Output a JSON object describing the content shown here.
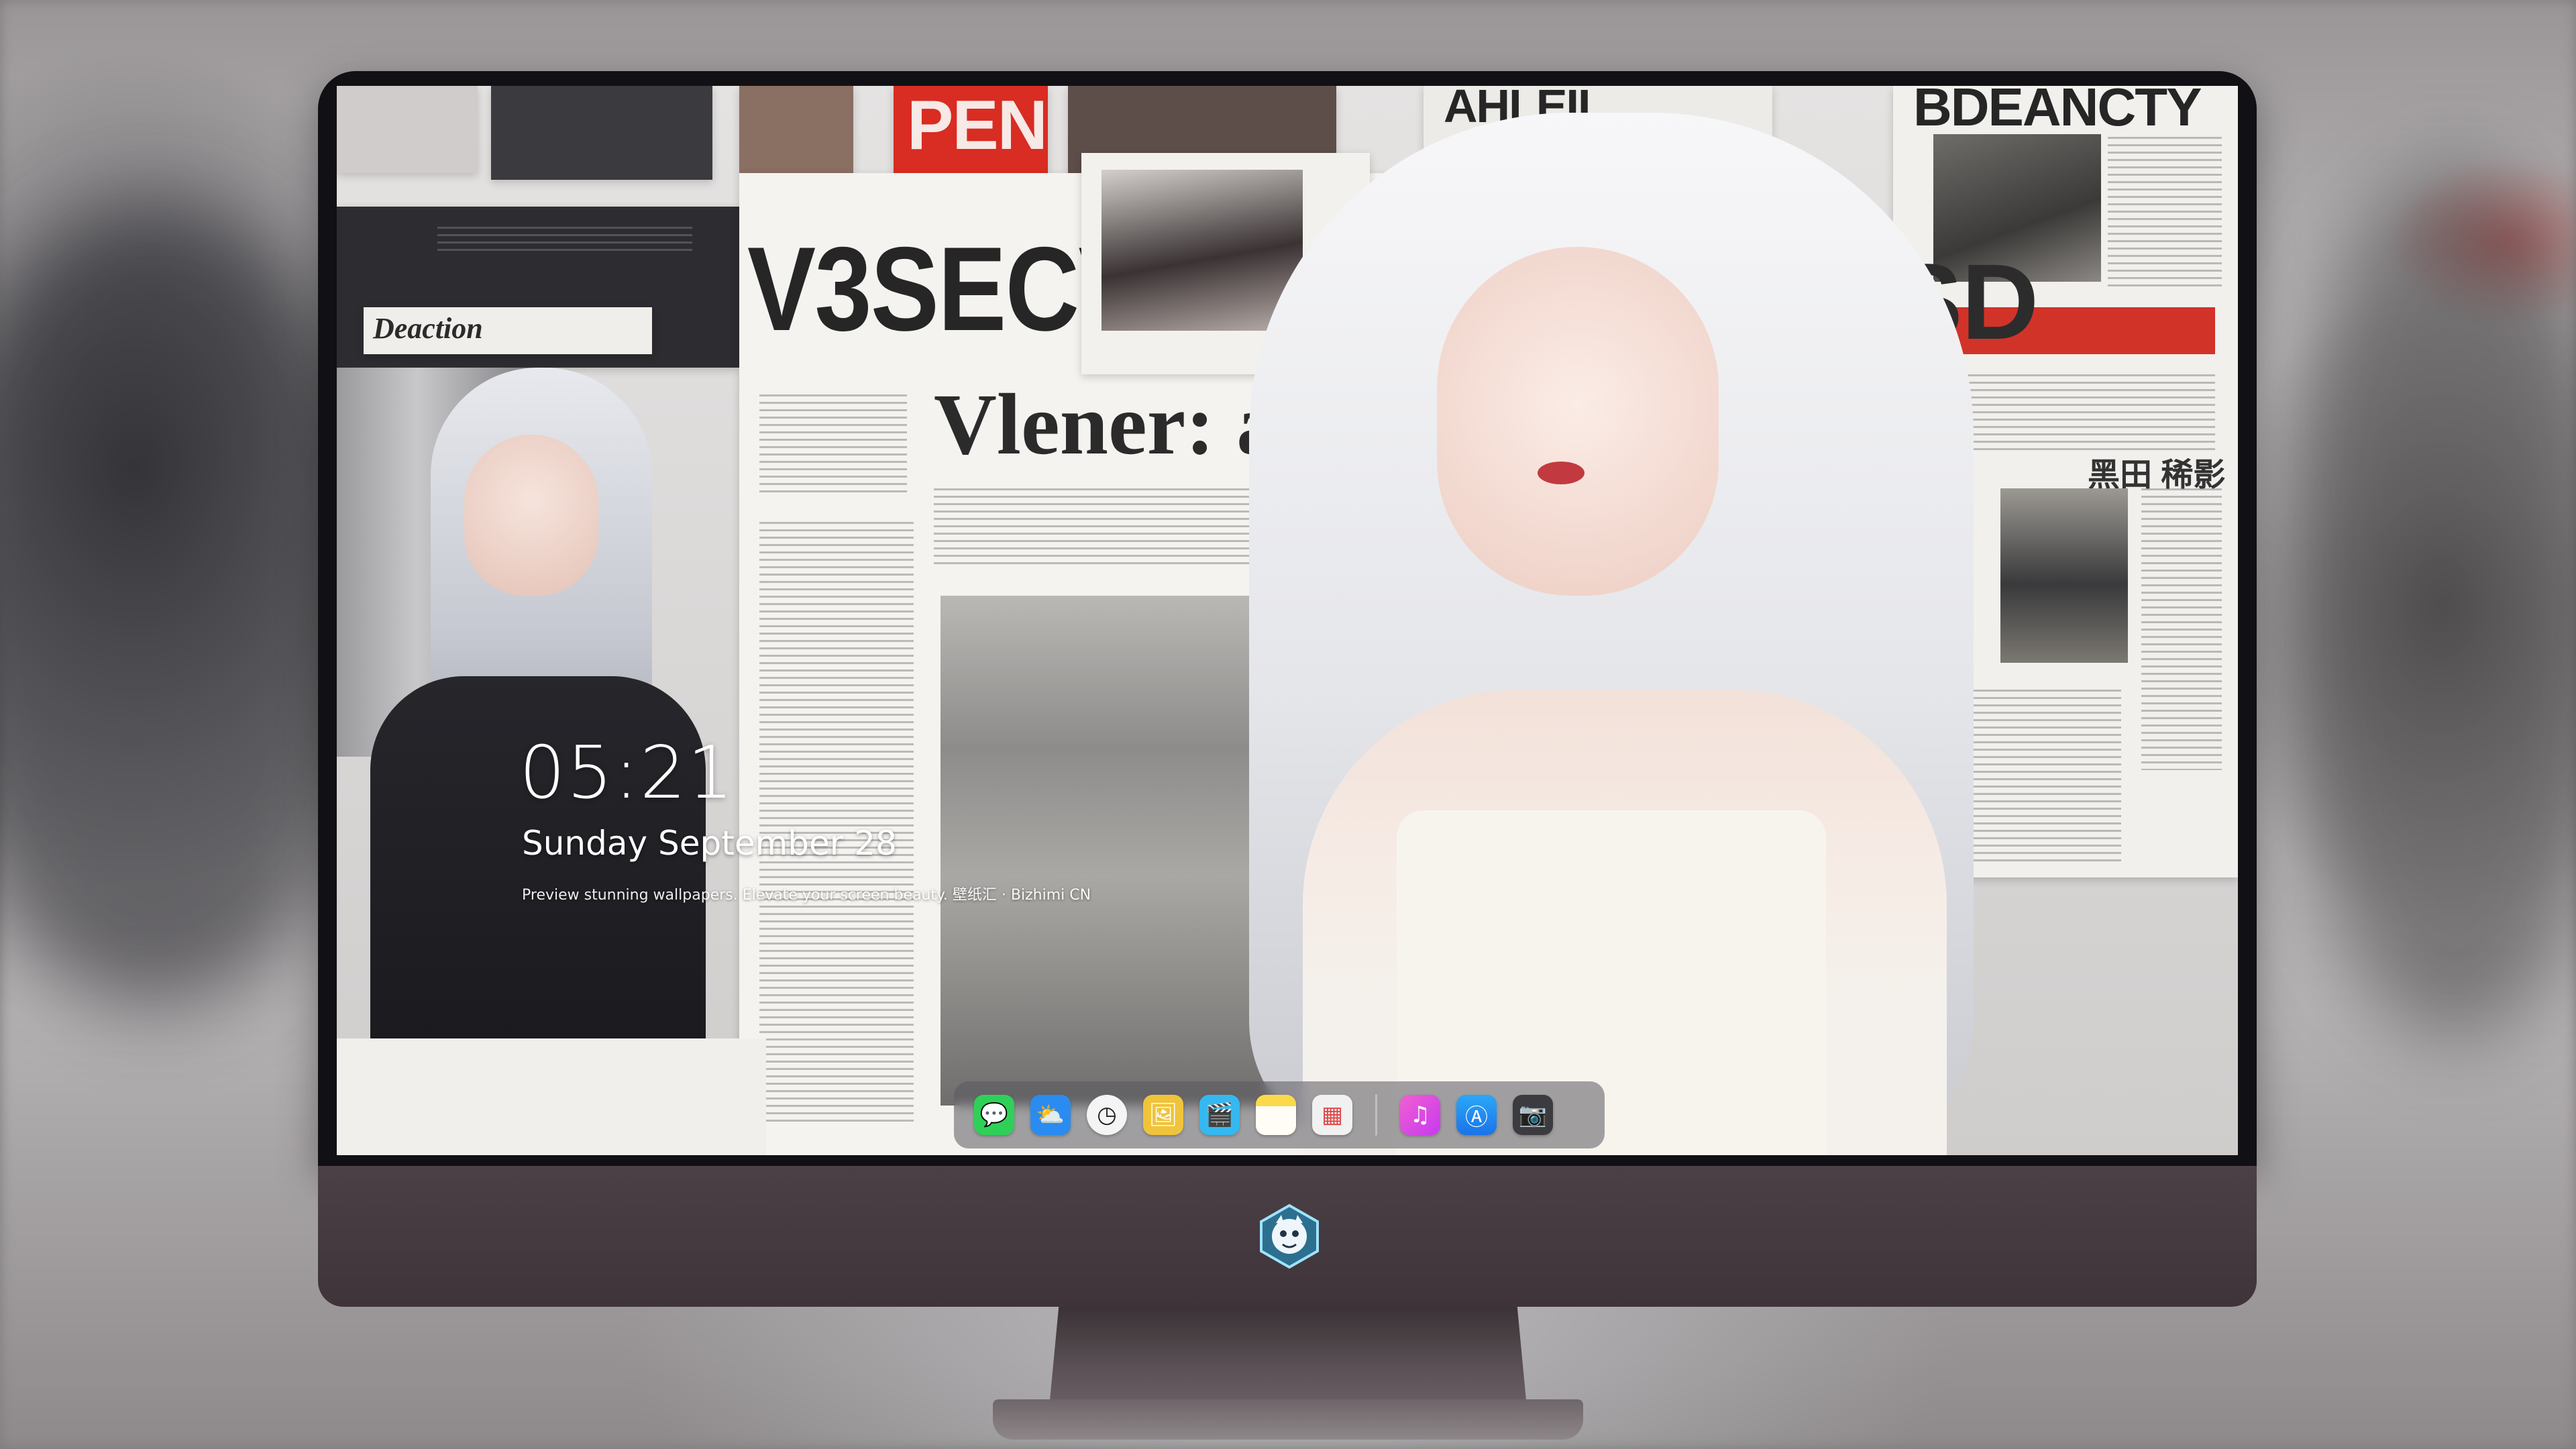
{
  "lock_screen": {
    "time": "05:21",
    "date": "Sunday September  28",
    "caption": "Preview stunning wallpapers. Elevate your screen beauty. 壁纸汇 · Bizhimi CN"
  },
  "wallpaper": {
    "headlines": {
      "main": "V3SECVEY",
      "serif": "Vlener:  am",
      "top_right": "BDEANCTY",
      "top_center": "AHLEII",
      "red_poster": "PEN",
      "side_caption": "Deaction",
      "column_right": "JSD",
      "right_small": "黑田 稀影"
    }
  },
  "dock": {
    "apps": [
      {
        "name": "messages-icon",
        "glyph": "💬",
        "color": "#2fd058"
      },
      {
        "name": "weather-icon",
        "glyph": "⛅",
        "color": "#2a8cf0"
      },
      {
        "name": "clock-icon",
        "glyph": "◷",
        "color": "#f4f4f4"
      },
      {
        "name": "preview-icon",
        "glyph": "🖼",
        "color": "#f0c43a"
      },
      {
        "name": "clips-icon",
        "glyph": "🎬",
        "color": "#35b8f0"
      },
      {
        "name": "notes-icon",
        "glyph": "",
        "color": "#fbd94a"
      },
      {
        "name": "photos-grid-icon",
        "glyph": "▦",
        "color": "#e04848"
      },
      {
        "name": "music-icon",
        "glyph": "♫",
        "color": "#e94fd8"
      },
      {
        "name": "app-store-icon",
        "glyph": "Ⓐ",
        "color": "#1f8ff5"
      },
      {
        "name": "camera-icon",
        "glyph": "📷",
        "color": "#3c3c40"
      }
    ]
  },
  "colors": {
    "bezel": "#111015",
    "chin": "#44393e",
    "accent_red": "#c8322a"
  }
}
